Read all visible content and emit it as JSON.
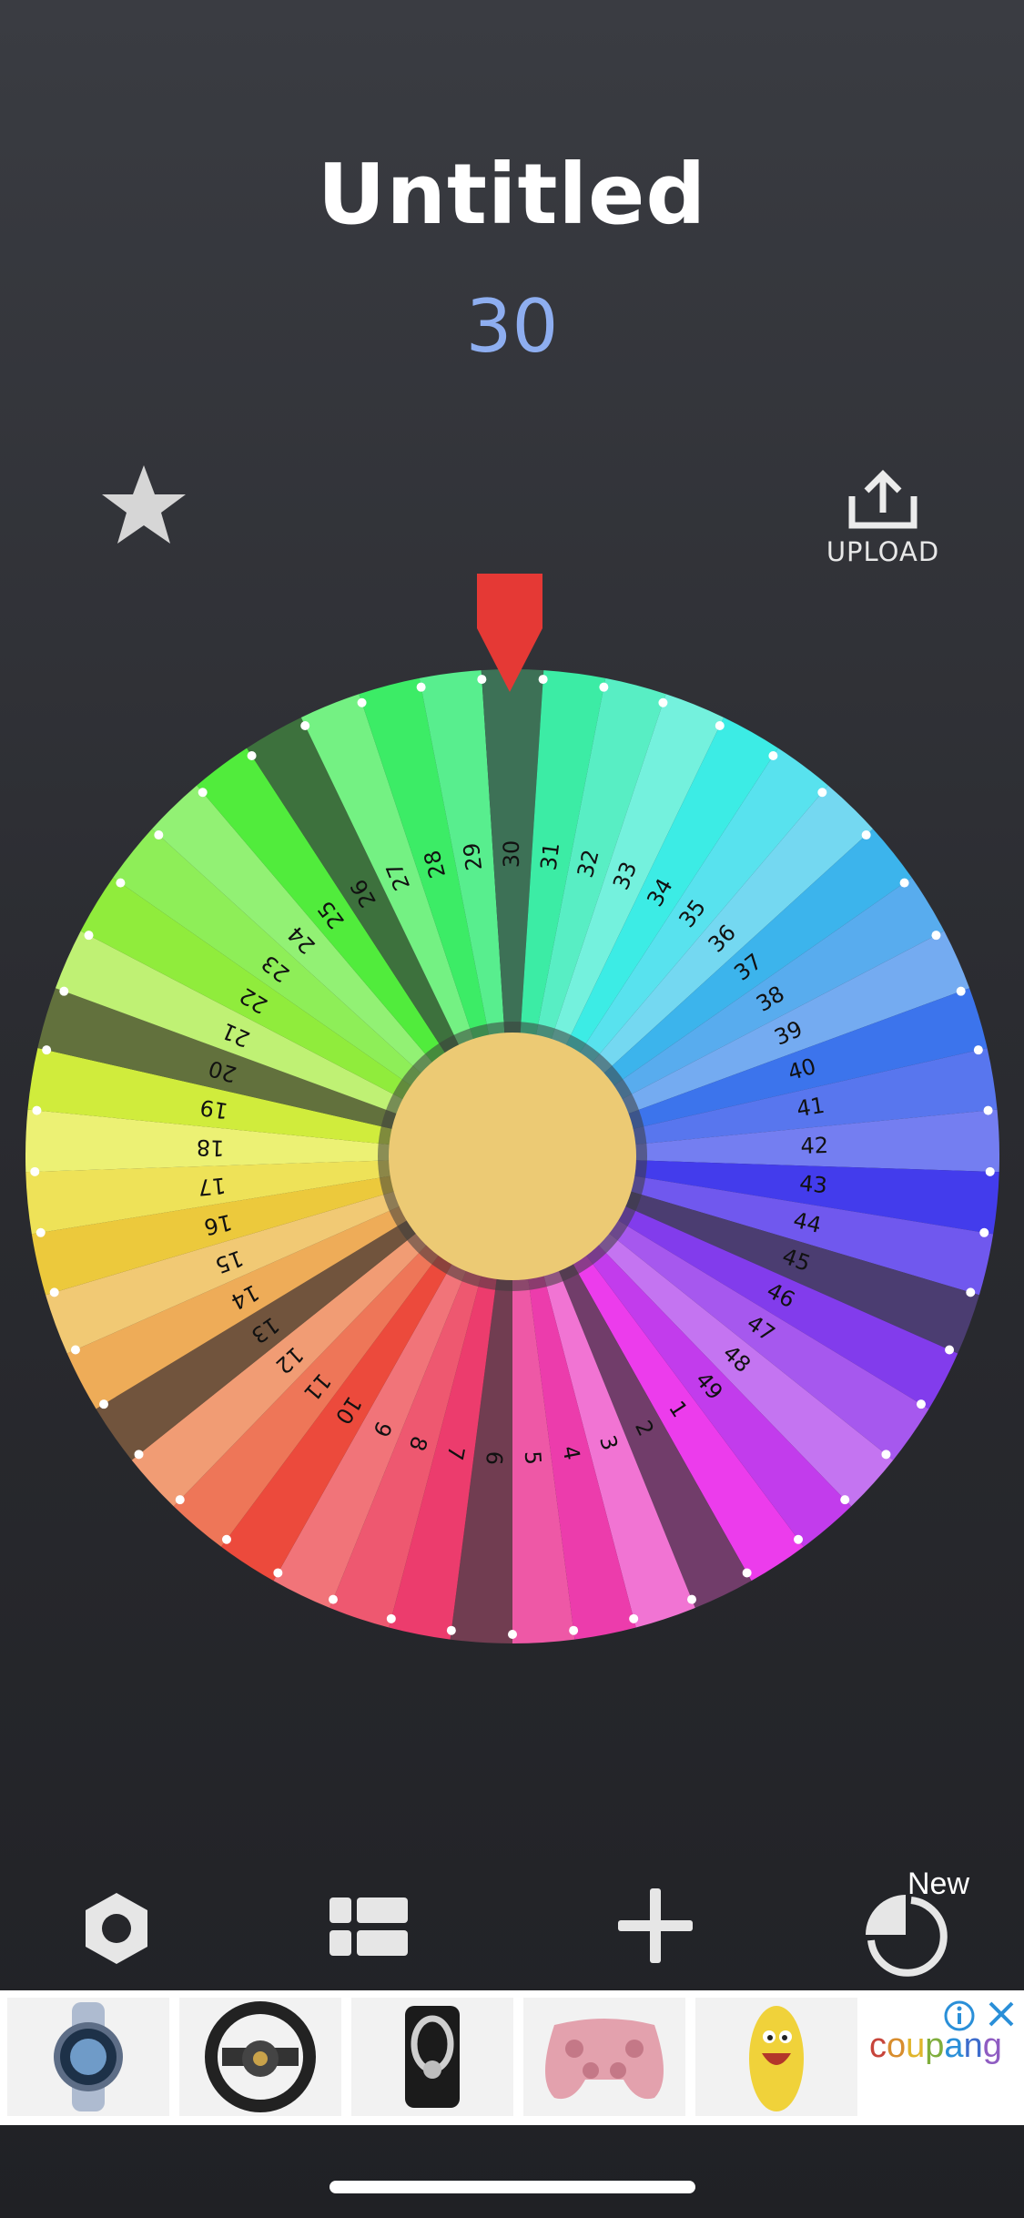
{
  "app": {
    "title": "Untitled",
    "result": "30"
  },
  "top_actions": {
    "favorite_icon": "star-icon",
    "upload_icon": "upload-icon",
    "upload_label": "UPLOAD"
  },
  "wheel": {
    "segment_labels": [
      "1",
      "2",
      "3",
      "4",
      "5",
      "6",
      "7",
      "8",
      "9",
      "10",
      "11",
      "12",
      "13",
      "14",
      "15",
      "16",
      "17",
      "18",
      "19",
      "20",
      "21",
      "22",
      "23",
      "24",
      "25",
      "26",
      "27",
      "28",
      "29",
      "30",
      "31",
      "32",
      "33",
      "34",
      "35",
      "36",
      "37",
      "38",
      "39",
      "40",
      "41",
      "42",
      "43",
      "44",
      "45",
      "46",
      "47",
      "48",
      "49"
    ],
    "center_color": "#ecca74",
    "pointer_color": "#e53935"
  },
  "toolbar": {
    "settings_icon": "gear-icon",
    "list_icon": "list-icon",
    "add_icon": "plus-icon",
    "new_spin_icon": "pie-timer-icon",
    "new_badge": "New"
  },
  "ad": {
    "items": [
      "smartwatch",
      "steering-wheel",
      "phone-ring-holder",
      "pink-game-controller",
      "yellow-toy"
    ],
    "brand": "coupang",
    "info_icon": "info-icon",
    "close_icon": "close-icon"
  }
}
